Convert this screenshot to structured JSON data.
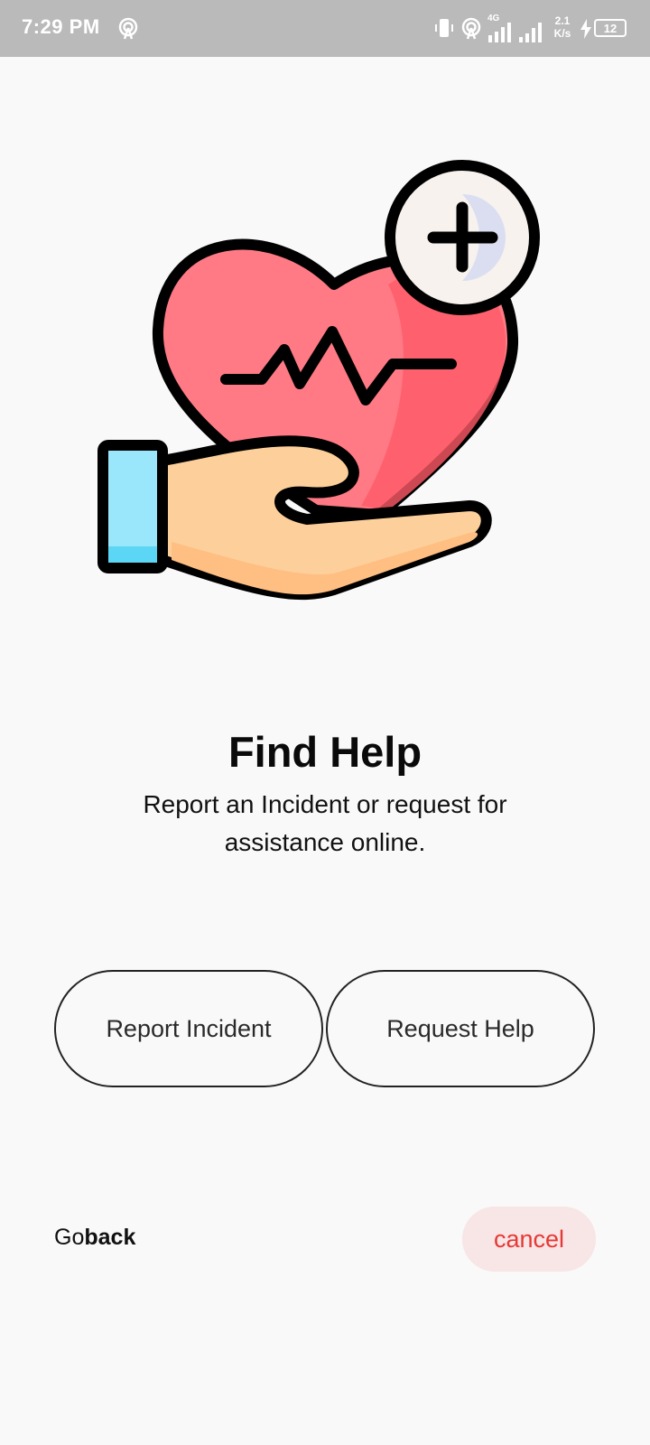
{
  "status_bar": {
    "time": "7:29 PM",
    "network_label": "4G",
    "speed_value": "2.1",
    "speed_unit": "K/s",
    "battery": "12",
    "icons": [
      "hotspot-icon",
      "vibrate-icon",
      "hotspot-icon",
      "signal-icon",
      "signal-icon",
      "charging-icon",
      "battery-icon"
    ]
  },
  "illustration": {
    "name": "heart-in-hand-icon",
    "colors": {
      "heart": "#ff7a85",
      "hand": "#fdd09b",
      "cuff": "#9ae6fb",
      "plus_badge": "#f7f2ee",
      "outline": "#000000"
    }
  },
  "content": {
    "title": "Find Help",
    "subtitle": "Report an Incident or request for assistance online."
  },
  "actions": {
    "report_label": "Report Incident",
    "request_label": "Request Help"
  },
  "footer": {
    "goback_light": "Go",
    "goback_bold": "back",
    "cancel_label": "cancel"
  },
  "colors": {
    "status_bar_bg": "#bababa",
    "page_bg": "#f9f9f9",
    "cancel_text": "#e53935",
    "cancel_bg": "#f8e5e5"
  }
}
